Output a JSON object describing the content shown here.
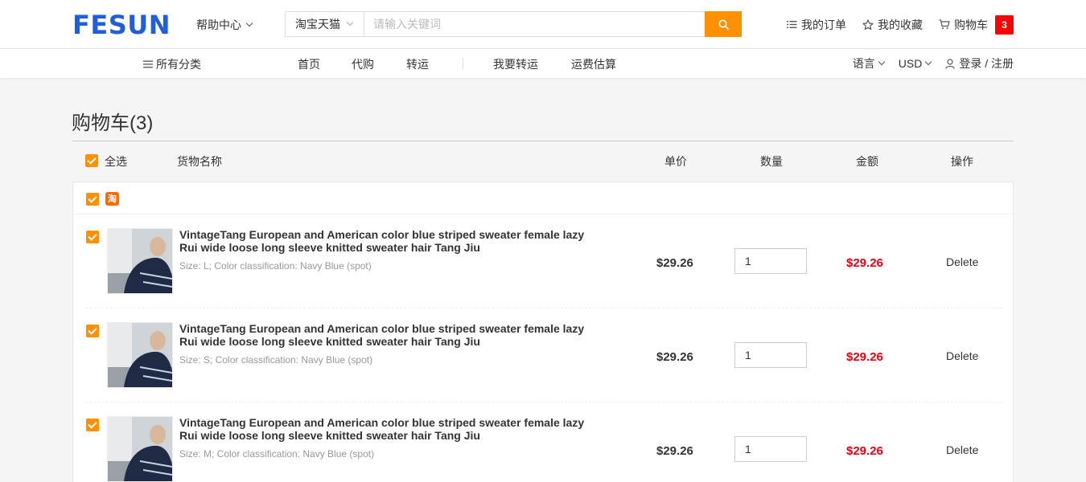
{
  "header": {
    "logo": "FESUN",
    "help_label": "帮助中心",
    "search": {
      "selector": "淘宝天猫",
      "placeholder": "请输入关键词"
    },
    "links": {
      "orders": "我的订单",
      "favorites": "我的收藏",
      "cart": "购物车",
      "cart_count": "3"
    }
  },
  "nav": {
    "all_categories": "所有分类",
    "items": [
      "首页",
      "代购",
      "转运",
      "我要转运",
      "运费估算"
    ],
    "language": "语言",
    "currency": "USD",
    "login": "登录 / 注册"
  },
  "cart": {
    "title": "购物车(3)",
    "columns": {
      "select_all": "全选",
      "name": "货物名称",
      "unit_price": "单价",
      "quantity": "数量",
      "amount": "金额",
      "action": "操作"
    },
    "shop_icon": "淘",
    "items": [
      {
        "title": "VintageTang European and American color blue striped sweater female lazy Rui wide loose long sleeve knitted sweater hair Tang Jiu",
        "spec": "Size: L; Color classification: Navy Blue (spot)",
        "price": "$29.26",
        "qty": "1",
        "total": "$29.26",
        "action": "Delete"
      },
      {
        "title": "VintageTang European and American color blue striped sweater female lazy Rui wide loose long sleeve knitted sweater hair Tang Jiu",
        "spec": "Size: S; Color classification: Navy Blue (spot)",
        "price": "$29.26",
        "qty": "1",
        "total": "$29.26",
        "action": "Delete"
      },
      {
        "title": "VintageTang European and American color blue striped sweater female lazy Rui wide loose long sleeve knitted sweater hair Tang Jiu",
        "spec": "Size: M; Color classification: Navy Blue (spot)",
        "price": "$29.26",
        "qty": "1",
        "total": "$29.26",
        "action": "Delete"
      }
    ]
  },
  "colors": {
    "brand": "#1f5fdc",
    "accent": "#ff9000",
    "price_red": "#e60012",
    "badge_red": "#ff0000"
  }
}
